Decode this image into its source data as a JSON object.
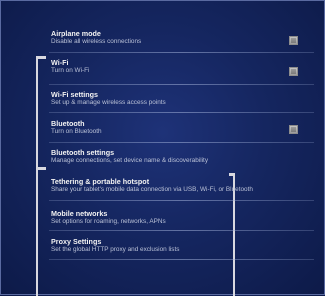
{
  "settings": {
    "items": [
      {
        "title": "Airplane mode",
        "subtitle": "Disable all wireless connections",
        "has_checkbox": true
      },
      {
        "title": "Wi-Fi",
        "subtitle": "Turn on Wi-Fi",
        "has_checkbox": true
      },
      {
        "title": "Wi-Fi settings",
        "subtitle": "Set up & manage wireless access points",
        "has_checkbox": false
      },
      {
        "title": "Bluetooth",
        "subtitle": "Turn on Bluetooth",
        "has_checkbox": true
      },
      {
        "title": "Bluetooth settings",
        "subtitle": "Manage connections, set device name & discoverability",
        "has_checkbox": false
      },
      {
        "title": "Tethering & portable hotspot",
        "subtitle": "Share your tablet's mobile data connection via USB, Wi-Fi, or Bluetooth",
        "has_checkbox": false
      },
      {
        "title": "Mobile networks",
        "subtitle": "Set options for roaming, networks, APNs",
        "has_checkbox": false
      },
      {
        "title": "Proxy Settings",
        "subtitle": "Set the global HTTP proxy and exclusion lists",
        "has_checkbox": false
      }
    ]
  }
}
